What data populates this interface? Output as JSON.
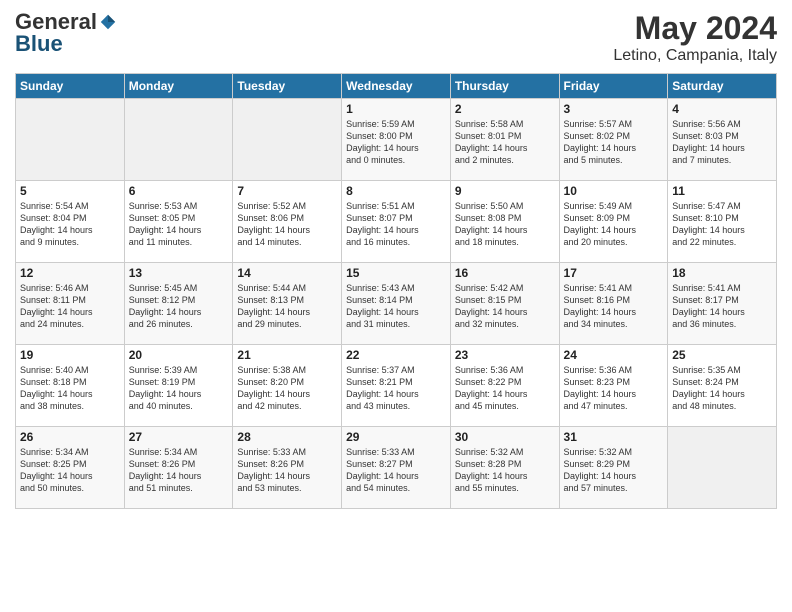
{
  "header": {
    "logo_general": "General",
    "logo_blue": "Blue",
    "title_month": "May 2024",
    "title_location": "Letino, Campania, Italy"
  },
  "weekdays": [
    "Sunday",
    "Monday",
    "Tuesday",
    "Wednesday",
    "Thursday",
    "Friday",
    "Saturday"
  ],
  "weeks": [
    [
      {
        "day": "",
        "info": ""
      },
      {
        "day": "",
        "info": ""
      },
      {
        "day": "",
        "info": ""
      },
      {
        "day": "1",
        "info": "Sunrise: 5:59 AM\nSunset: 8:00 PM\nDaylight: 14 hours\nand 0 minutes."
      },
      {
        "day": "2",
        "info": "Sunrise: 5:58 AM\nSunset: 8:01 PM\nDaylight: 14 hours\nand 2 minutes."
      },
      {
        "day": "3",
        "info": "Sunrise: 5:57 AM\nSunset: 8:02 PM\nDaylight: 14 hours\nand 5 minutes."
      },
      {
        "day": "4",
        "info": "Sunrise: 5:56 AM\nSunset: 8:03 PM\nDaylight: 14 hours\nand 7 minutes."
      }
    ],
    [
      {
        "day": "5",
        "info": "Sunrise: 5:54 AM\nSunset: 8:04 PM\nDaylight: 14 hours\nand 9 minutes."
      },
      {
        "day": "6",
        "info": "Sunrise: 5:53 AM\nSunset: 8:05 PM\nDaylight: 14 hours\nand 11 minutes."
      },
      {
        "day": "7",
        "info": "Sunrise: 5:52 AM\nSunset: 8:06 PM\nDaylight: 14 hours\nand 14 minutes."
      },
      {
        "day": "8",
        "info": "Sunrise: 5:51 AM\nSunset: 8:07 PM\nDaylight: 14 hours\nand 16 minutes."
      },
      {
        "day": "9",
        "info": "Sunrise: 5:50 AM\nSunset: 8:08 PM\nDaylight: 14 hours\nand 18 minutes."
      },
      {
        "day": "10",
        "info": "Sunrise: 5:49 AM\nSunset: 8:09 PM\nDaylight: 14 hours\nand 20 minutes."
      },
      {
        "day": "11",
        "info": "Sunrise: 5:47 AM\nSunset: 8:10 PM\nDaylight: 14 hours\nand 22 minutes."
      }
    ],
    [
      {
        "day": "12",
        "info": "Sunrise: 5:46 AM\nSunset: 8:11 PM\nDaylight: 14 hours\nand 24 minutes."
      },
      {
        "day": "13",
        "info": "Sunrise: 5:45 AM\nSunset: 8:12 PM\nDaylight: 14 hours\nand 26 minutes."
      },
      {
        "day": "14",
        "info": "Sunrise: 5:44 AM\nSunset: 8:13 PM\nDaylight: 14 hours\nand 29 minutes."
      },
      {
        "day": "15",
        "info": "Sunrise: 5:43 AM\nSunset: 8:14 PM\nDaylight: 14 hours\nand 31 minutes."
      },
      {
        "day": "16",
        "info": "Sunrise: 5:42 AM\nSunset: 8:15 PM\nDaylight: 14 hours\nand 32 minutes."
      },
      {
        "day": "17",
        "info": "Sunrise: 5:41 AM\nSunset: 8:16 PM\nDaylight: 14 hours\nand 34 minutes."
      },
      {
        "day": "18",
        "info": "Sunrise: 5:41 AM\nSunset: 8:17 PM\nDaylight: 14 hours\nand 36 minutes."
      }
    ],
    [
      {
        "day": "19",
        "info": "Sunrise: 5:40 AM\nSunset: 8:18 PM\nDaylight: 14 hours\nand 38 minutes."
      },
      {
        "day": "20",
        "info": "Sunrise: 5:39 AM\nSunset: 8:19 PM\nDaylight: 14 hours\nand 40 minutes."
      },
      {
        "day": "21",
        "info": "Sunrise: 5:38 AM\nSunset: 8:20 PM\nDaylight: 14 hours\nand 42 minutes."
      },
      {
        "day": "22",
        "info": "Sunrise: 5:37 AM\nSunset: 8:21 PM\nDaylight: 14 hours\nand 43 minutes."
      },
      {
        "day": "23",
        "info": "Sunrise: 5:36 AM\nSunset: 8:22 PM\nDaylight: 14 hours\nand 45 minutes."
      },
      {
        "day": "24",
        "info": "Sunrise: 5:36 AM\nSunset: 8:23 PM\nDaylight: 14 hours\nand 47 minutes."
      },
      {
        "day": "25",
        "info": "Sunrise: 5:35 AM\nSunset: 8:24 PM\nDaylight: 14 hours\nand 48 minutes."
      }
    ],
    [
      {
        "day": "26",
        "info": "Sunrise: 5:34 AM\nSunset: 8:25 PM\nDaylight: 14 hours\nand 50 minutes."
      },
      {
        "day": "27",
        "info": "Sunrise: 5:34 AM\nSunset: 8:26 PM\nDaylight: 14 hours\nand 51 minutes."
      },
      {
        "day": "28",
        "info": "Sunrise: 5:33 AM\nSunset: 8:26 PM\nDaylight: 14 hours\nand 53 minutes."
      },
      {
        "day": "29",
        "info": "Sunrise: 5:33 AM\nSunset: 8:27 PM\nDaylight: 14 hours\nand 54 minutes."
      },
      {
        "day": "30",
        "info": "Sunrise: 5:32 AM\nSunset: 8:28 PM\nDaylight: 14 hours\nand 55 minutes."
      },
      {
        "day": "31",
        "info": "Sunrise: 5:32 AM\nSunset: 8:29 PM\nDaylight: 14 hours\nand 57 minutes."
      },
      {
        "day": "",
        "info": ""
      }
    ]
  ]
}
